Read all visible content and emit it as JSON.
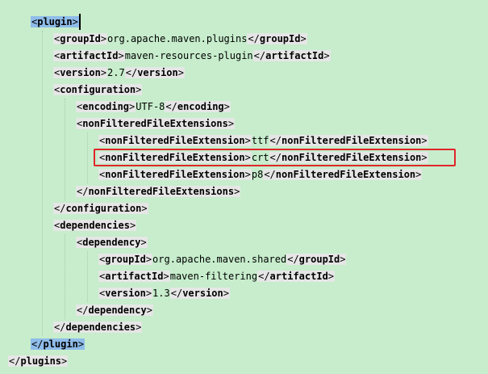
{
  "editor": {
    "colors": {
      "background": "#c7edcc",
      "tag_background": "#e6e6e6",
      "matched_tag_background": "#8fbce9",
      "annotation_box": "#e0262a"
    },
    "lines": [
      {
        "open": "plugin",
        "matched": true
      },
      {
        "open": "groupId",
        "value": "org.apache.maven.plugins",
        "close": "groupId"
      },
      {
        "open": "artifactId",
        "value": "maven-resources-plugin",
        "close": "artifactId"
      },
      {
        "open": "version",
        "value": "2.7",
        "close": "version"
      },
      {
        "open": "configuration"
      },
      {
        "open": "encoding",
        "value": "UTF-8",
        "close": "encoding"
      },
      {
        "open": "nonFilteredFileExtensions"
      },
      {
        "open": "nonFilteredFileExtension",
        "value": "ttf",
        "close": "nonFilteredFileExtension"
      },
      {
        "open": "nonFilteredFileExtension",
        "value": "crt",
        "close": "nonFilteredFileExtension",
        "annotated": true
      },
      {
        "open": "nonFilteredFileExtension",
        "value": "p8",
        "close": "nonFilteredFileExtension"
      },
      {
        "close": "nonFilteredFileExtensions"
      },
      {
        "close": "configuration"
      },
      {
        "open": "dependencies"
      },
      {
        "open": "dependency"
      },
      {
        "open": "groupId",
        "value": "org.apache.maven.shared",
        "close": "groupId"
      },
      {
        "open": "artifactId",
        "value": "maven-filtering",
        "close": "artifactId"
      },
      {
        "open": "version",
        "value": "1.3",
        "close": "version"
      },
      {
        "close": "dependency"
      },
      {
        "close": "dependencies"
      },
      {
        "close": "plugin",
        "matched": true
      },
      {
        "close": "plugins"
      }
    ]
  }
}
